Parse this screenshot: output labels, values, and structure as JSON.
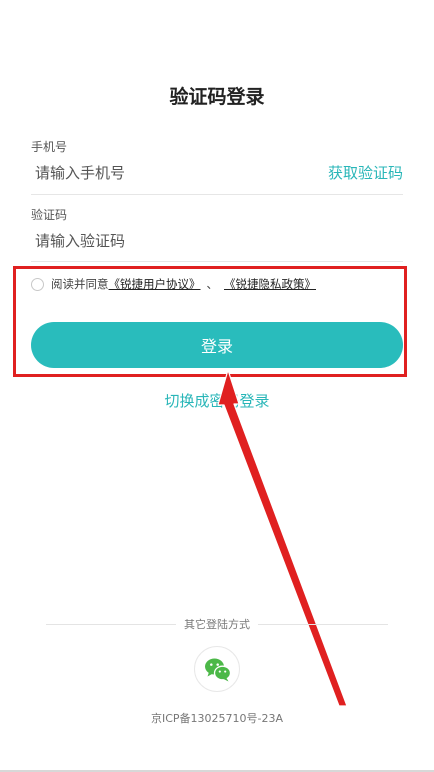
{
  "title": "验证码登录",
  "phone": {
    "label": "手机号",
    "placeholder": "请输入手机号",
    "get_code_label": "获取验证码"
  },
  "code": {
    "label": "验证码",
    "placeholder": "请输入验证码"
  },
  "agreement": {
    "prefix": "阅读并同意",
    "user_agreement": "《锐捷用户协议》",
    "separator": "、",
    "privacy_policy": "《锐捷隐私政策》"
  },
  "login_button": "登录",
  "switch_link": "切换成密码登录",
  "other_login": {
    "label": "其它登陆方式",
    "icon": "wechat-icon"
  },
  "footer": {
    "icp": "京ICP备13025710号-23A"
  },
  "colors": {
    "accent": "#29bcbc",
    "annotation": "#e02020"
  }
}
